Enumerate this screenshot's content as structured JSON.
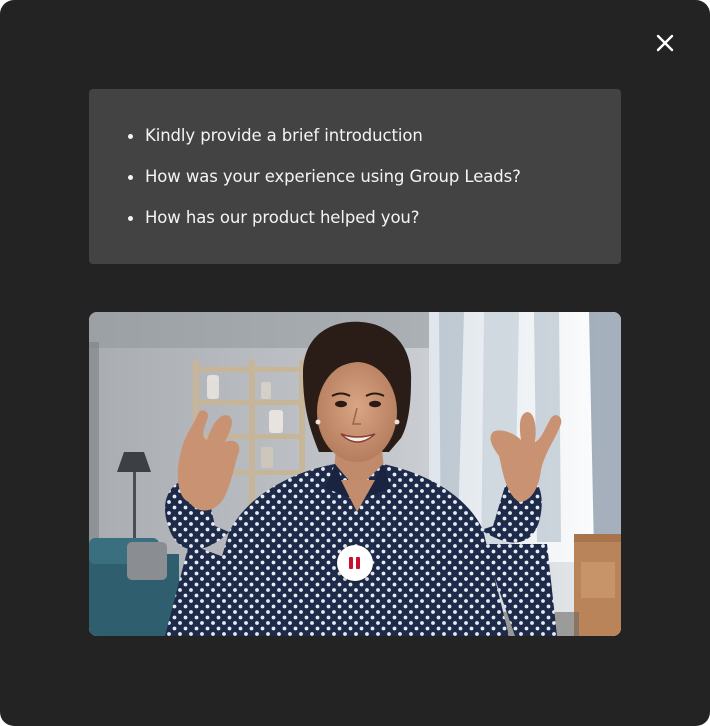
{
  "prompts": [
    "Kindly provide a brief introduction",
    "How was your experience using Group Leads?",
    "How has our product helped you?"
  ],
  "icons": {
    "close": "close-icon",
    "pause": "pause-icon"
  },
  "colors": {
    "modal_background": "#232323",
    "prompt_panel": "#434343",
    "prompt_text": "#f4f4f4",
    "pause_accent": "#c8102e"
  }
}
